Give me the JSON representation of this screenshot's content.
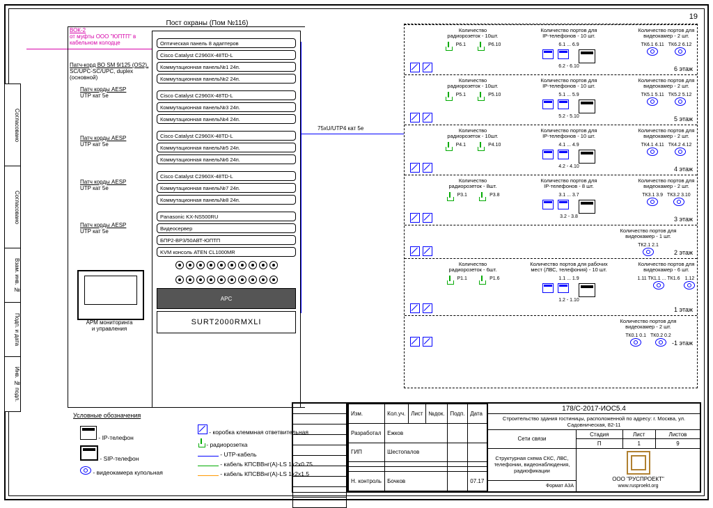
{
  "page_number": "19",
  "side_tabs": [
    "Согласовано",
    "Согласовано",
    "Взам. инв. №",
    "Подп. и дата",
    "Инв. № подл."
  ],
  "vok_note": {
    "l1": "ВОК-2",
    "l2": "от муфты ООО \"ЮПТП\" в",
    "l3": "кабельном колодце"
  },
  "guard_post": {
    "title": "Пост охраны (Пом №116)",
    "patch_main": {
      "l1": "Патч-корд ВО SM 9/125 (OS2),",
      "l2": "SC/UPC-SC/UPC, duplex",
      "l3": "(основной)"
    },
    "patch_aesup": {
      "l1": "Патч корды AESP",
      "l2": "UTP кат 5е"
    }
  },
  "rack_items": [
    "Оптическая панель 8 адаптеров",
    "Cisco Catalyst C2960X-48TD-L",
    "Коммутационная панель№1 24п.",
    "Коммутационная панель№2 24п.",
    "Cisco Catalyst C2960X-48TD-L",
    "Коммутационная панель№3 24п.",
    "Коммутационная панель№4 24п.",
    "Cisco Catalyst C2960X-48TD-L",
    "Коммутационная панель№5 24п.",
    "Коммутационная панель№6 24п.",
    "Cisco Catalyst C2960X-48TD-L",
    "Коммутационная панель№7 24п.",
    "Коммутационная панель№8 24п.",
    "Panasonic KX-NS500RU",
    "Видеосервер",
    "БПР2-ВР3/50АВТ-ЮПТП",
    "KVM консоль ATEN CL1000MR"
  ],
  "ups_label": "SURT2000RMXLI",
  "apc_label": "APC",
  "monitor_label": "АРМ мониторинга\nи управления",
  "trunk_label": "75хU/UTP4 кат 5е",
  "legend": {
    "title": "Условные обозначения",
    "items_left": [
      {
        "name": "- IP-телефон"
      },
      {
        "name": "- SIP-телефон"
      },
      {
        "name": "- видеокамера купольная"
      }
    ],
    "items_right": [
      {
        "name": "- коробка клеммная ответвительная"
      },
      {
        "name": "- радиорозетка"
      },
      {
        "name": "- UTP-кабель",
        "color": "#00f"
      },
      {
        "name": "- кабель КПСВВнг(А)-LS 1x2x0.75",
        "color": "#0a0"
      },
      {
        "name": "- кабель КПСВВнг(А)-LS 1x2x1.5",
        "color": "#f90"
      }
    ]
  },
  "floors": [
    {
      "label": "6 этаж",
      "radio": {
        "hdr": "Количество\nрадиорозеток - 10шт.",
        "ports": [
          "P6.1",
          "P6.10"
        ]
      },
      "ip": {
        "hdr": "Количество портов для\nIP-телефонов - 10 шт.",
        "ports": [
          "6.1 ... 6.9",
          "6.2 - 6.10"
        ]
      },
      "cam": {
        "hdr": "Количество портов для\nвидеокамер - 2 шт.",
        "ports": [
          "ТК6.1 6.11",
          "ТК6.2 6.12"
        ]
      }
    },
    {
      "label": "5 этаж",
      "radio": {
        "hdr": "Количество\nрадиорозеток - 10шт.",
        "ports": [
          "P5.1",
          "P5.10"
        ]
      },
      "ip": {
        "hdr": "Количество портов для\nIP-телефонов - 10 шт.",
        "ports": [
          "5.1 ... 5.9",
          "5.2 - 5.10"
        ]
      },
      "cam": {
        "hdr": "Количество портов для\nвидеокамер - 2 шт.",
        "ports": [
          "ТК5.1 5.11",
          "ТК5.2 5.12"
        ]
      }
    },
    {
      "label": "4 этаж",
      "radio": {
        "hdr": "Количество\nрадиорозеток - 10шт.",
        "ports": [
          "P4.1",
          "P4.10"
        ]
      },
      "ip": {
        "hdr": "Количество портов для\nIP-телефонов - 10 шт.",
        "ports": [
          "4.1 ... 4.9",
          "4.2 - 4.10"
        ]
      },
      "cam": {
        "hdr": "Количество портов для\nвидеокамер - 2 шт.",
        "ports": [
          "ТК4.1 4.11",
          "ТК4.2 4.12"
        ]
      }
    },
    {
      "label": "3 этаж",
      "radio": {
        "hdr": "Количество\nрадиорозеток - 8шт.",
        "ports": [
          "P3.1",
          "P3.8"
        ]
      },
      "ip": {
        "hdr": "Количество портов для\nIP-телефонов - 8 шт.",
        "ports": [
          "3.1 ... 3.7",
          "3.2 - 3.8"
        ]
      },
      "cam": {
        "hdr": "Количество портов для\nвидеокамер - 2 шт.",
        "ports": [
          "ТК3.1 3.9",
          "ТК3.2 3.10"
        ]
      }
    },
    {
      "label": "2 этаж",
      "cam": {
        "hdr": "Количество портов для\nвидеокамер - 1 шт.",
        "ports": [
          "ТК2.1 2.1"
        ]
      }
    },
    {
      "label": "1 этаж",
      "radio": {
        "hdr": "Количество\nрадиорозеток - 6шт.",
        "ports": [
          "P1.1",
          "P1.6"
        ]
      },
      "ip": {
        "hdr": "Количество портов для рабочих\nмест (ЛВС, телефония) - 10 шт.",
        "ports": [
          "1.1 ... 1.9",
          "1.2 - 1.10"
        ]
      },
      "cam": {
        "hdr": "Количество портов для\nвидеокамер - 6 шт.",
        "ports": [
          "1.11 ТК1.1 ... ТК1.6",
          "1.12"
        ]
      }
    },
    {
      "label": "-1 этаж",
      "cam": {
        "hdr": "Количество портов для\nвидеокамер - 2 шт.",
        "ports": [
          "ТК0.1 0.1",
          "ТК0.2 0.2"
        ]
      }
    }
  ],
  "titleblock": {
    "doc_no": "178/С-2017-ИОС5.4",
    "project": "Строительство здания гостиницы, расположенной по адресу: г. Москва, ул. Садовническая, 82-11",
    "section": "Сети связи",
    "drawing": "Структурная схема СКС, ЛВС, телефонии, видеонаблюдения, радиофикации",
    "stage_lbl": "Стадия",
    "sheet_lbl": "Лист",
    "sheets_lbl": "Листов",
    "stage": "П",
    "sheet": "1",
    "sheets": "9",
    "org": "ООО \"РУСПРОЕКТ\"",
    "org_url": "www.rusproekt.org",
    "rev_hdrs": [
      "Изм.",
      "Кол.уч.",
      "Лист",
      "№док.",
      "Подп.",
      "Дата"
    ],
    "roles": [
      [
        "Разработал",
        "Ежков"
      ],
      [
        "ГИП",
        "Шестопалов"
      ],
      [
        "Н. контроль",
        "Бочков",
        "07.17"
      ]
    ],
    "format": "Формат А3А"
  }
}
